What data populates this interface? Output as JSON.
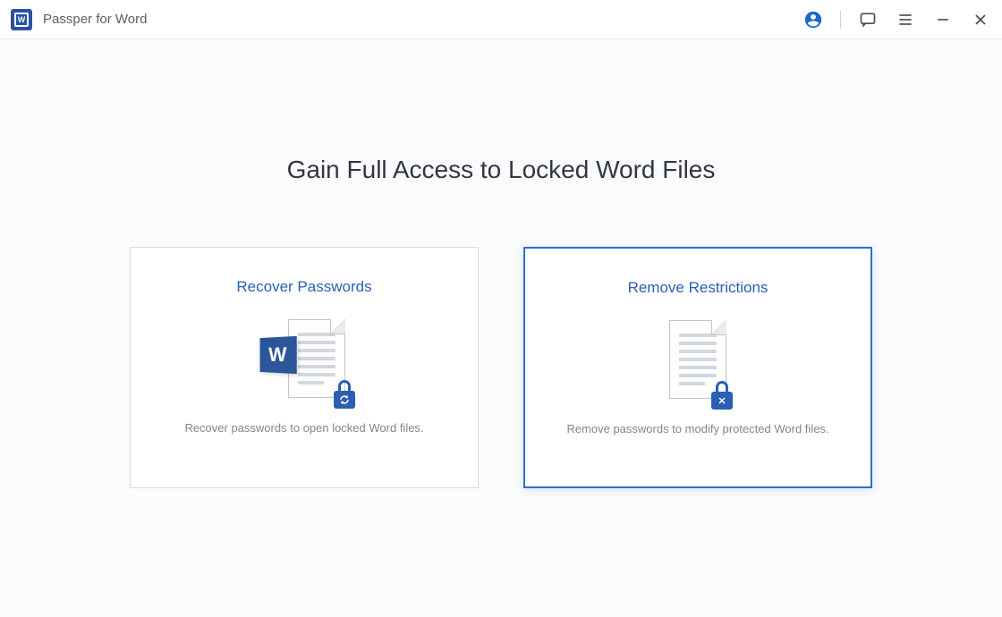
{
  "app": {
    "title": "Passper for Word",
    "logo_letter": "W"
  },
  "titlebar": {
    "icons": {
      "account": "account-circle-icon",
      "feedback": "chat-icon",
      "menu": "menu-icon",
      "minimize": "minimize-icon",
      "close": "close-icon"
    }
  },
  "main": {
    "headline": "Gain Full Access to Locked Word Files"
  },
  "options": [
    {
      "id": "recover",
      "title": "Recover Passwords",
      "description": "Recover passwords to open locked Word files.",
      "active": false,
      "illustration": "word-doc-lock-refresh"
    },
    {
      "id": "remove",
      "title": "Remove Restrictions",
      "description": "Remove passwords to modify protected Word files.",
      "active": true,
      "illustration": "doc-lock-remove"
    }
  ],
  "colors": {
    "accent": "#2a5fb3",
    "word_brand": "#2b579a",
    "border_active": "#2f6fcf",
    "text_primary": "#333740",
    "text_secondary": "#808590"
  }
}
